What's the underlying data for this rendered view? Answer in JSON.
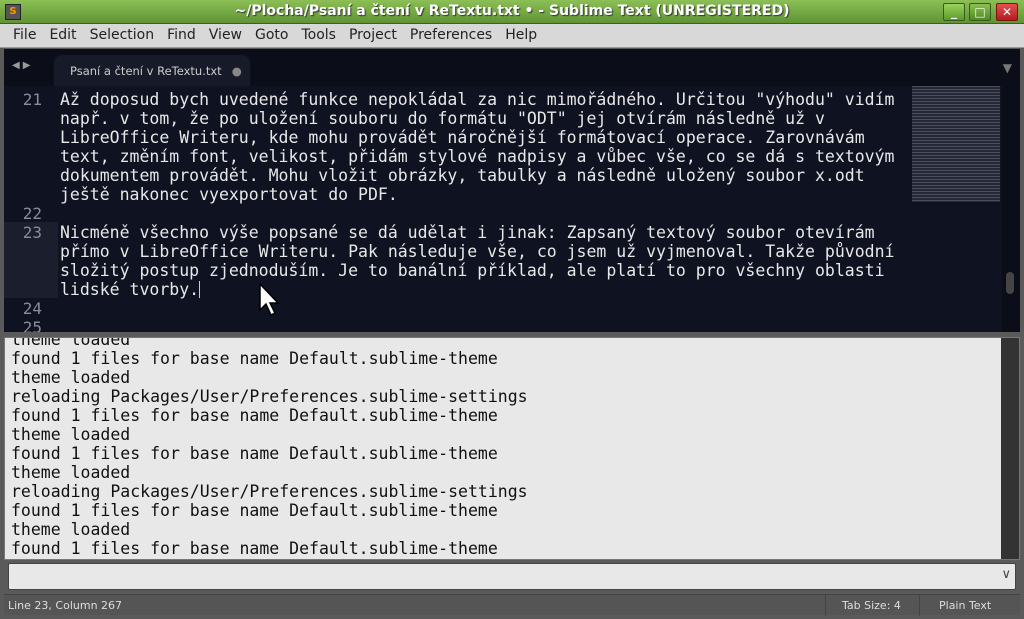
{
  "window": {
    "title": "~/Plocha/Psaní a čtení v ReTextu.txt • - Sublime Text (UNREGISTERED)",
    "minimize": "_",
    "maximize": "□",
    "close": "✕"
  },
  "menu": [
    "File",
    "Edit",
    "Selection",
    "Find",
    "View",
    "Goto",
    "Tools",
    "Project",
    "Preferences",
    "Help"
  ],
  "tab": {
    "label": "Psaní a čtení v ReTextu.txt",
    "modified_indicator": "●"
  },
  "editor": {
    "line_numbers": [
      "21",
      "22",
      "23",
      "24",
      "25"
    ],
    "line21": [
      "Až doposud bych uvedené funkce nepokládal za nic mimořádného. Určitou \"výhodu\" vidím",
      "např. v tom, že po uložení souboru do formátu \"ODT\" jej otvírám následně už v",
      "LibreOffice Writeru, kde mohu provádět náročnější formátovací operace. Zarovnávám",
      "text, změním font, velikost, přidám stylové nadpisy a vůbec vše, co se dá s textovým",
      "dokumentem provádět. Mohu vložit obrázky, tabulky a následně uložený soubor x.odt",
      "ještě nakonec vyexportovat do PDF."
    ],
    "line23": [
      "Nicméně všechno výše popsané se dá udělat i jinak: Zapsaný textový soubor otevírám",
      "přímo v LibreOffice Writeru. Pak následuje vše, co jsem už vyjmenoval. Takže původní",
      "složitý postup zjednoduším. Je to banální příklad, ale platí to pro všechny oblasti",
      "lidské tvorby."
    ]
  },
  "console": [
    "theme loaded",
    "found 1 files for base name Default.sublime-theme",
    "theme loaded",
    "reloading Packages/User/Preferences.sublime-settings",
    "found 1 files for base name Default.sublime-theme",
    "theme loaded",
    "found 1 files for base name Default.sublime-theme",
    "theme loaded",
    "reloading Packages/User/Preferences.sublime-settings",
    "found 1 files for base name Default.sublime-theme",
    "theme loaded",
    "found 1 files for base name Default.sublime-theme"
  ],
  "command_input": {
    "value": ""
  },
  "status": {
    "position": "Line 23, Column 267",
    "tab_size": "Tab Size: 4",
    "syntax": "Plain Text"
  }
}
